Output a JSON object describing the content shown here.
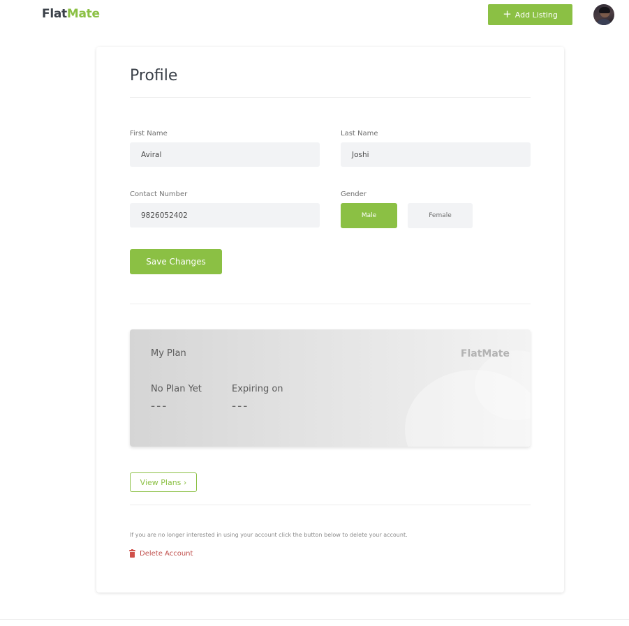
{
  "header": {
    "logo_part1": "Flat",
    "logo_part2": "Mate",
    "add_listing_label": "Add Listing"
  },
  "profile": {
    "title": "Profile",
    "first_name": {
      "label": "First Name",
      "value": "Aviral"
    },
    "last_name": {
      "label": "Last Name",
      "value": "Joshi"
    },
    "contact": {
      "label": "Contact Number",
      "value": "9826052402"
    },
    "gender": {
      "label": "Gender",
      "options": [
        "Male",
        "Female"
      ],
      "selected": "Male"
    },
    "save_label": "Save Changes"
  },
  "plan": {
    "title": "My Plan",
    "brand": "FlatMate",
    "status_label": "No Plan Yet",
    "status_value": "---",
    "expiry_label": "Expiring on",
    "expiry_value": "---",
    "view_plans_label": "View Plans ›"
  },
  "account": {
    "delete_note": "If you are no longer interested in using your account click the button below to delete your account.",
    "delete_label": "Delete Account"
  },
  "colors": {
    "accent": "#8bc044",
    "danger": "#c0504d"
  }
}
